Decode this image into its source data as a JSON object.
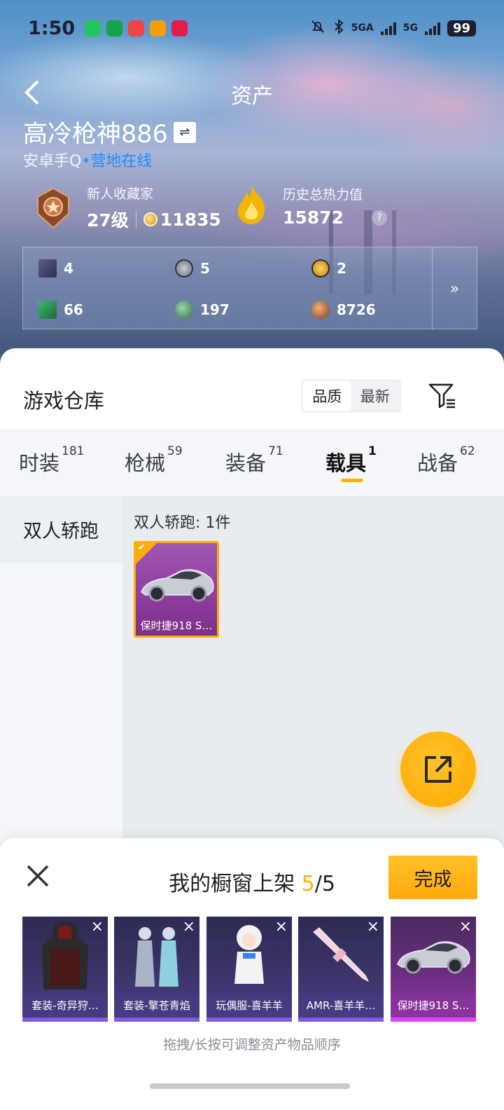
{
  "status_bar": {
    "time": "1:50",
    "network_1": "5GA",
    "network_2": "5G",
    "battery": "99",
    "app_icon_colors": [
      "#22c55e",
      "#16a34a",
      "#ef4444",
      "#f59e0b",
      "#e11d48"
    ]
  },
  "header": {
    "title": "资产",
    "back_icon": "chevron-left-icon"
  },
  "profile": {
    "username": "高冷枪神886",
    "switch_icon": "⇌",
    "platform": "安卓手Q",
    "status_dot": "•",
    "status": "营地在线"
  },
  "collector": {
    "title": "新人收藏家",
    "level": "27级",
    "coins": "11835"
  },
  "heat": {
    "label": "历史总热力值",
    "value": "15872",
    "help": "?"
  },
  "stats": {
    "items": [
      {
        "icon": "card-icon",
        "value": "4"
      },
      {
        "icon": "silver-coin-icon",
        "value": "5"
      },
      {
        "icon": "gold-badge-icon",
        "value": "2"
      },
      {
        "icon": "green-card-icon",
        "value": "66"
      },
      {
        "icon": "green-orb-icon",
        "value": "197"
      },
      {
        "icon": "bronze-orb-icon",
        "value": "8726"
      }
    ],
    "more": "»"
  },
  "warehouse": {
    "title": "游戏仓库",
    "sort_options": [
      "品质",
      "最新"
    ],
    "active_sort": "品质"
  },
  "category_tabs": [
    {
      "label": "时装",
      "count": "181"
    },
    {
      "label": "枪械",
      "count": "59"
    },
    {
      "label": "装备",
      "count": "71"
    },
    {
      "label": "载具",
      "count": "1",
      "active": true
    },
    {
      "label": "战备",
      "count": "62"
    }
  ],
  "sub_categories": [
    "双人轿跑"
  ],
  "items_section": {
    "group_label": "双人轿跑: 1件",
    "items": [
      {
        "label": "保时捷918 S…",
        "selected": true
      }
    ]
  },
  "showcase": {
    "title_prefix": "我的橱窗上架",
    "count_current": "5",
    "count_total": "/5",
    "done_label": "完成",
    "slots": [
      {
        "label": "套装-奇异狩…"
      },
      {
        "label": "套装-擎苍青焰"
      },
      {
        "label": "玩偶服-喜羊羊"
      },
      {
        "label": "AMR-喜羊羊…"
      },
      {
        "label": "保时捷918 S…"
      }
    ],
    "remove_icon": "×",
    "hint": "拖拽/长按可调整资产物品顺序"
  },
  "colors": {
    "accent": "#ffb300",
    "link_blue": "#1f8cff",
    "card_purple": "#8f3f9e"
  }
}
